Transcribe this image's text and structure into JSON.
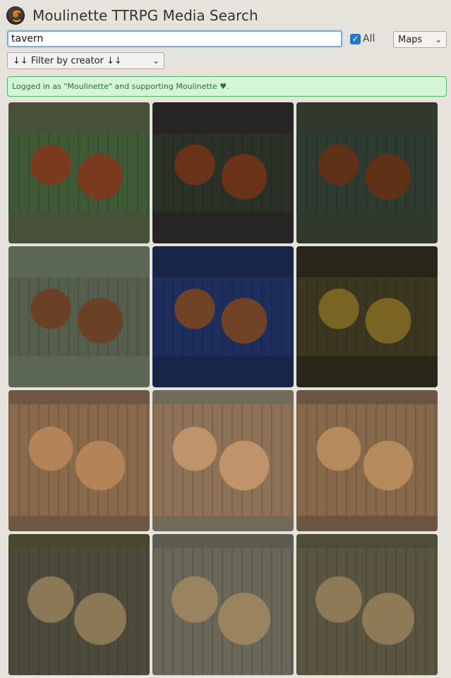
{
  "header": {
    "title": "Moulinette TTRPG Media Search",
    "logo_icon": "moulinette-logo-icon"
  },
  "search": {
    "value": "tavern",
    "placeholder": ""
  },
  "all_toggle": {
    "label": "All",
    "checked": true
  },
  "type_select": {
    "selected": "Maps"
  },
  "creator_filter": {
    "selected": "↓↓ Filter by creator ↓↓"
  },
  "notice": {
    "text": "Logged in as \"Moulinette\" and supporting Moulinette ♥."
  },
  "results": [
    {
      "bg": "#47513a",
      "map": "#3f5a36",
      "accent": "#7a3a1e"
    },
    {
      "bg": "#272524",
      "map": "#2a3026",
      "accent": "#6a3219"
    },
    {
      "bg": "#30392c",
      "map": "#2e3b31",
      "accent": "#5f3117"
    },
    {
      "bg": "#5c6654",
      "map": "#565f4e",
      "accent": "#6a4124"
    },
    {
      "bg": "#192548",
      "map": "#1d2e5c",
      "accent": "#704226"
    },
    {
      "bg": "#282619",
      "map": "#3a3620",
      "accent": "#7a6424"
    },
    {
      "bg": "#6f5843",
      "map": "#8a6a4c",
      "accent": "#b48458"
    },
    {
      "bg": "#716a58",
      "map": "#8d7258",
      "accent": "#c0936a"
    },
    {
      "bg": "#6b5643",
      "map": "#86684b",
      "accent": "#b68a5c"
    },
    {
      "bg": "#49482f",
      "map": "#4c4a3a",
      "accent": "#8a7856"
    },
    {
      "bg": "#5d5c4e",
      "map": "#6a6658",
      "accent": "#9a8460"
    },
    {
      "bg": "#4f4c38",
      "map": "#595541",
      "accent": "#8e7a56"
    }
  ]
}
